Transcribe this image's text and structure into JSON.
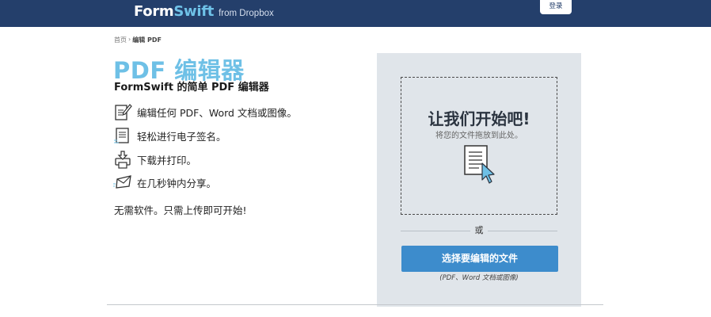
{
  "header": {
    "logo_text_1": "Form",
    "logo_text_2": "Swift",
    "logo_sub": "from Dropbox",
    "login_label": "登录",
    "bg_color": "#243f6b"
  },
  "breadcrumb": {
    "home": "首页",
    "separator": "›",
    "current": "编辑 PDF"
  },
  "main": {
    "title": "PDF 编辑器",
    "subtitle": "FormSwift 的简单 PDF 编辑器",
    "features": [
      {
        "icon": "edit-document-icon",
        "text": "编辑任何 PDF、Word 文档或图像。"
      },
      {
        "icon": "signature-icon",
        "text": "轻松进行电子签名。"
      },
      {
        "icon": "print-download-icon",
        "text": "下载并打印。"
      },
      {
        "icon": "send-envelope-icon",
        "text": "在几秒钟内分享。"
      }
    ],
    "tagline": "无需软件。只需上传即可开始!"
  },
  "upload": {
    "drop_title": "让我们开始吧!",
    "drop_hint": "将您的文件拖放到此处。",
    "or_text": "或",
    "button_label": "选择要编辑的文件",
    "file_types": "(PDF、Word 文档或图像)",
    "accent_color": "#3d8ccc",
    "panel_color": "#e0e5ea"
  }
}
